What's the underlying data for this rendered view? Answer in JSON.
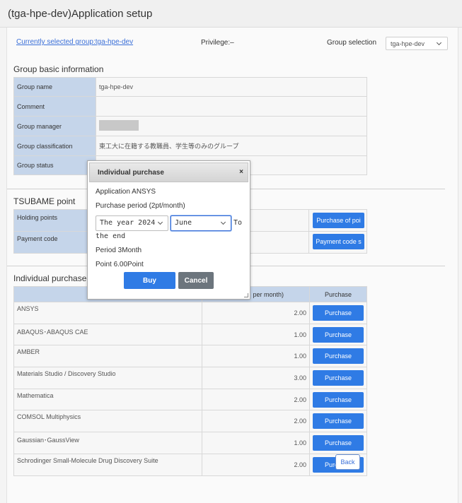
{
  "page_title": "(tga-hpe-dev)Application setup",
  "top_bar": {
    "current_group_link": "Currently selected group:tga-hpe-dev",
    "privilege_label": "Privilege:",
    "privilege_value": "–",
    "group_selection_label": "Group selection",
    "group_selection_value": "tga-hpe-dev"
  },
  "group_info": {
    "title": "Group basic information",
    "rows": [
      {
        "label": "Group name",
        "value": "tga-hpe-dev"
      },
      {
        "label": "Comment",
        "value": ""
      },
      {
        "label": "Group manager",
        "value": ""
      },
      {
        "label": "Group classification",
        "value": "東工大に在籍する教職員、学生等のみのグループ"
      },
      {
        "label": "Group status",
        "value": ""
      }
    ]
  },
  "tsubame": {
    "title": "TSUBAME point",
    "rows": [
      {
        "label": "Holding points",
        "button": "Purchase of poi"
      },
      {
        "label": "Payment code",
        "button": "Payment code s"
      }
    ]
  },
  "individual_purchase": {
    "title": "Individual purchase",
    "header_points": "per month)",
    "header_action": "Purchase",
    "items": [
      {
        "name": "ANSYS",
        "points": "2.00",
        "action": "Purchase"
      },
      {
        "name": "ABAQUS･ABAQUS CAE",
        "points": "1.00",
        "action": "Purchase"
      },
      {
        "name": "AMBER",
        "points": "1.00",
        "action": "Purchase"
      },
      {
        "name": "Materials Studio / Discovery Studio",
        "points": "3.00",
        "action": "Purchase"
      },
      {
        "name": "Mathematica",
        "points": "2.00",
        "action": "Purchase"
      },
      {
        "name": "COMSOL Multiphysics",
        "points": "2.00",
        "action": "Purchase"
      },
      {
        "name": "Gaussian･GaussView",
        "points": "1.00",
        "action": "Purchase"
      },
      {
        "name": "Schrodinger Small-Molecule Drug Discovery Suite",
        "points": "2.00",
        "action": "Purchase"
      }
    ],
    "back_button": "Back"
  },
  "modal": {
    "title": "Individual purchase",
    "close_glyph": "×",
    "application_line": "Application ANSYS",
    "period_line": "Purchase period (2pt/month)",
    "year_value": "The year 2024",
    "month_value": "June",
    "to_label": "To",
    "end_label": "the end",
    "period_result": "Period 3Month",
    "point_result": "Point 6.00Point",
    "buy_button": "Buy",
    "cancel_button": "Cancel"
  }
}
